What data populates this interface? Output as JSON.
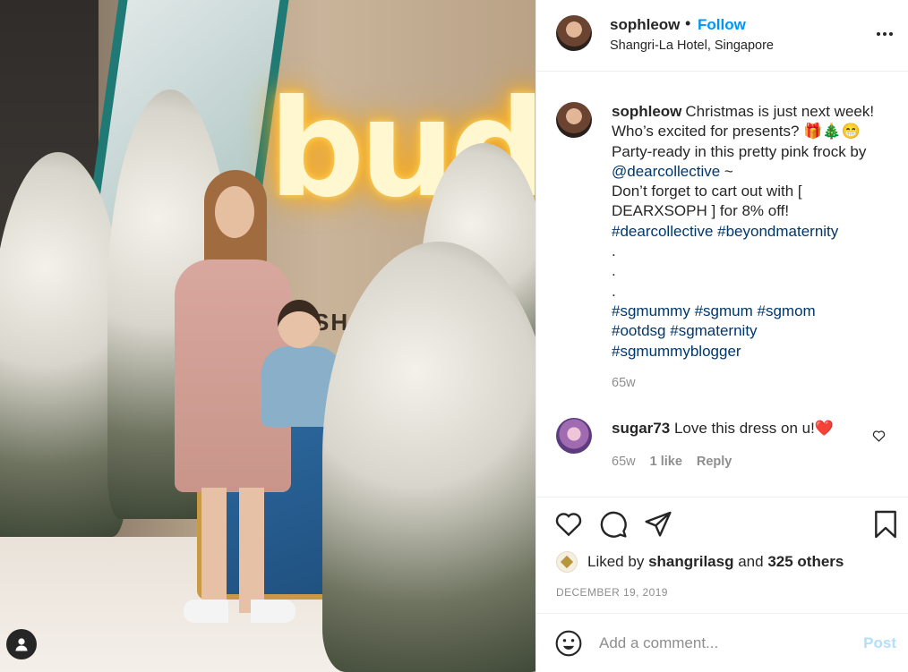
{
  "post": {
    "username": "sophleow",
    "follow_label": "Follow",
    "separator": "•",
    "location": "Shangri-La Hotel, Singapore",
    "photo_sign_text": "buds",
    "photo_sign_subtext": "SHANGRI-L"
  },
  "caption": {
    "username": "sophleow",
    "line1": "Christmas is just next week!",
    "line2": "Who’s excited for presents? 🎁🎄😁",
    "line3": "Party-ready in this pretty pink frock by",
    "mention": "@dearcollective",
    "mention_suffix": " ~",
    "line5": "Don’t forget to cart out with [",
    "line6": "DEARXSOPH ] for 8% off!",
    "hashtags1": [
      "#dearcollective",
      "#beyondmaternity"
    ],
    "dots": [
      ".",
      ".",
      "."
    ],
    "hashtags2": [
      "#sgmummy",
      "#sgmum",
      "#sgmom"
    ],
    "hashtags3": [
      "#ootdsg",
      "#sgmaternity"
    ],
    "hashtags4": [
      "#sgmummyblogger"
    ],
    "time": "65w"
  },
  "comment": {
    "username": "sugar73",
    "text": "Love this dress on u!❤️",
    "time": "65w",
    "likes": "1 like",
    "reply_label": "Reply"
  },
  "likes": {
    "prefix": "Liked by",
    "user": "shangrilasg",
    "joiner": "and",
    "others": "325 others"
  },
  "date": "December 19, 2019",
  "add_comment": {
    "placeholder": "Add a comment...",
    "post_label": "Post"
  },
  "icons": {
    "more": "more-options-icon",
    "heart": "heart-icon",
    "comment": "comment-icon",
    "share": "share-icon",
    "save": "bookmark-icon",
    "emoji": "emoji-icon",
    "user_tag": "user-tag-icon"
  },
  "colors": {
    "accent": "#0095f6",
    "link": "#00376b",
    "muted": "#8e8e8e",
    "post_disabled": "#b2dffc"
  }
}
